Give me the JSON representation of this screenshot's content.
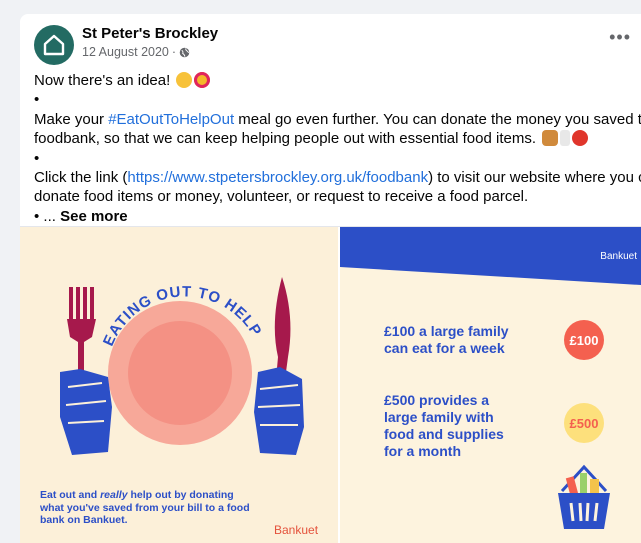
{
  "post": {
    "page_name": "St Peter's Brockley",
    "date": "12 August 2020",
    "separator": "·",
    "lines": [
      "Now there's an idea!",
      "•",
      "Make your",
      "#EatOutToHelpOut",
      "meal go even further. You can donate the money you saved to our",
      "foodbank, so that we can keep helping people out with essential food items.",
      "•",
      "Click the link (",
      "https://www.stpetersbrockley.org.uk/foodbank",
      ") to visit our website where you can",
      "donate food items or money, volunteer, or request to receive a food parcel.",
      "• ..."
    ],
    "see_more": "See more",
    "more_icon": "more-options-icon",
    "privacy_icon": "globe-icon"
  },
  "media": {
    "left": {
      "arc_text": "EATING OUT TO HELP OUT?",
      "caption_parts": [
        "Eat out and ",
        "really",
        " help out by donating what you've saved from your bill to a food bank on Bankuet."
      ],
      "brand": "Bankuet"
    },
    "right": {
      "brand": "Bankuet",
      "stat1": "£100 a large family can eat for a week",
      "badge1": "£100",
      "stat2": "£500 provides a large family with food and supplies for a month",
      "badge2": "£500"
    }
  },
  "colors": {
    "link": "#216fdb",
    "avatar_bg": "#236b63",
    "poster_blue": "#2c4fc7",
    "poster_cream": "#fcf0d9",
    "plate_pink": "#f7a899",
    "maroon": "#a6194c",
    "badge_red": "#f4604f",
    "badge_yellow": "#fde07c"
  }
}
